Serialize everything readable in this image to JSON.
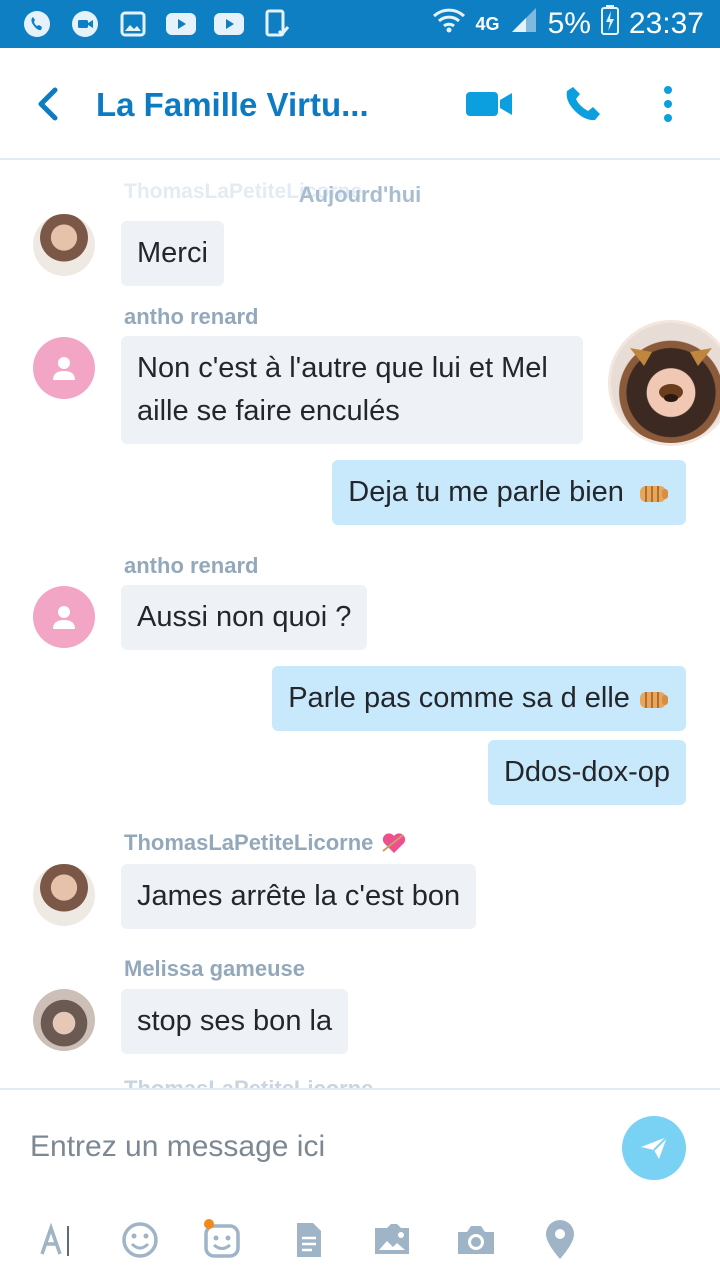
{
  "status_bar": {
    "network": "4G",
    "battery": "5%",
    "time": "23:37"
  },
  "header": {
    "back_icon": "chevron-left-icon",
    "title": "La Famille Virtu...",
    "actions": [
      "video-call-icon",
      "phone-icon",
      "more-vertical-icon"
    ]
  },
  "chat": {
    "ghost_sender": "ThomasLaPetiteLicorne",
    "date_separator": "Aujourd'hui",
    "messages": [
      {
        "direction": "in",
        "sender": "",
        "avatar": "thomas",
        "text": "Merci"
      },
      {
        "direction": "in",
        "sender": "antho renard",
        "avatar": "default",
        "text": "Non c'est à l'autre que lui et Mel aille se faire enculés"
      },
      {
        "direction": "out",
        "text": "Deja tu me parle bien",
        "emoji": "fist-emoji"
      },
      {
        "direction": "in",
        "sender": "antho renard",
        "avatar": "default",
        "text": "Aussi non quoi ?"
      },
      {
        "direction": "out",
        "text": "Parle pas comme sa d elle",
        "emoji": "fist-emoji"
      },
      {
        "direction": "out",
        "text": "Ddos-dox-op"
      },
      {
        "direction": "in",
        "sender": "ThomasLaPetiteLicorne",
        "avatar": "thomas",
        "text": "James arrête la c'est bon",
        "sender_emoji": "heart-emoji"
      },
      {
        "direction": "in",
        "sender": "Melissa gameuse",
        "avatar": "melissa",
        "text": "stop ses bon la"
      }
    ],
    "next_sender_partial": "ThomasLaPetiteLicorne"
  },
  "composer": {
    "placeholder": "Entrez un message ici",
    "tools": [
      "text-format-icon",
      "emoticon-icon",
      "mojis-icon",
      "file-icon",
      "media-gallery-icon",
      "camera-icon",
      "location-icon"
    ]
  },
  "colors": {
    "accent": "#0b7cc4",
    "status_bar": "#0e7fc2",
    "incoming_bubble": "#eef1f5",
    "outgoing_bubble": "#c8e9fb",
    "send_button": "#79d2f3",
    "default_avatar": "#f3a5c5"
  }
}
